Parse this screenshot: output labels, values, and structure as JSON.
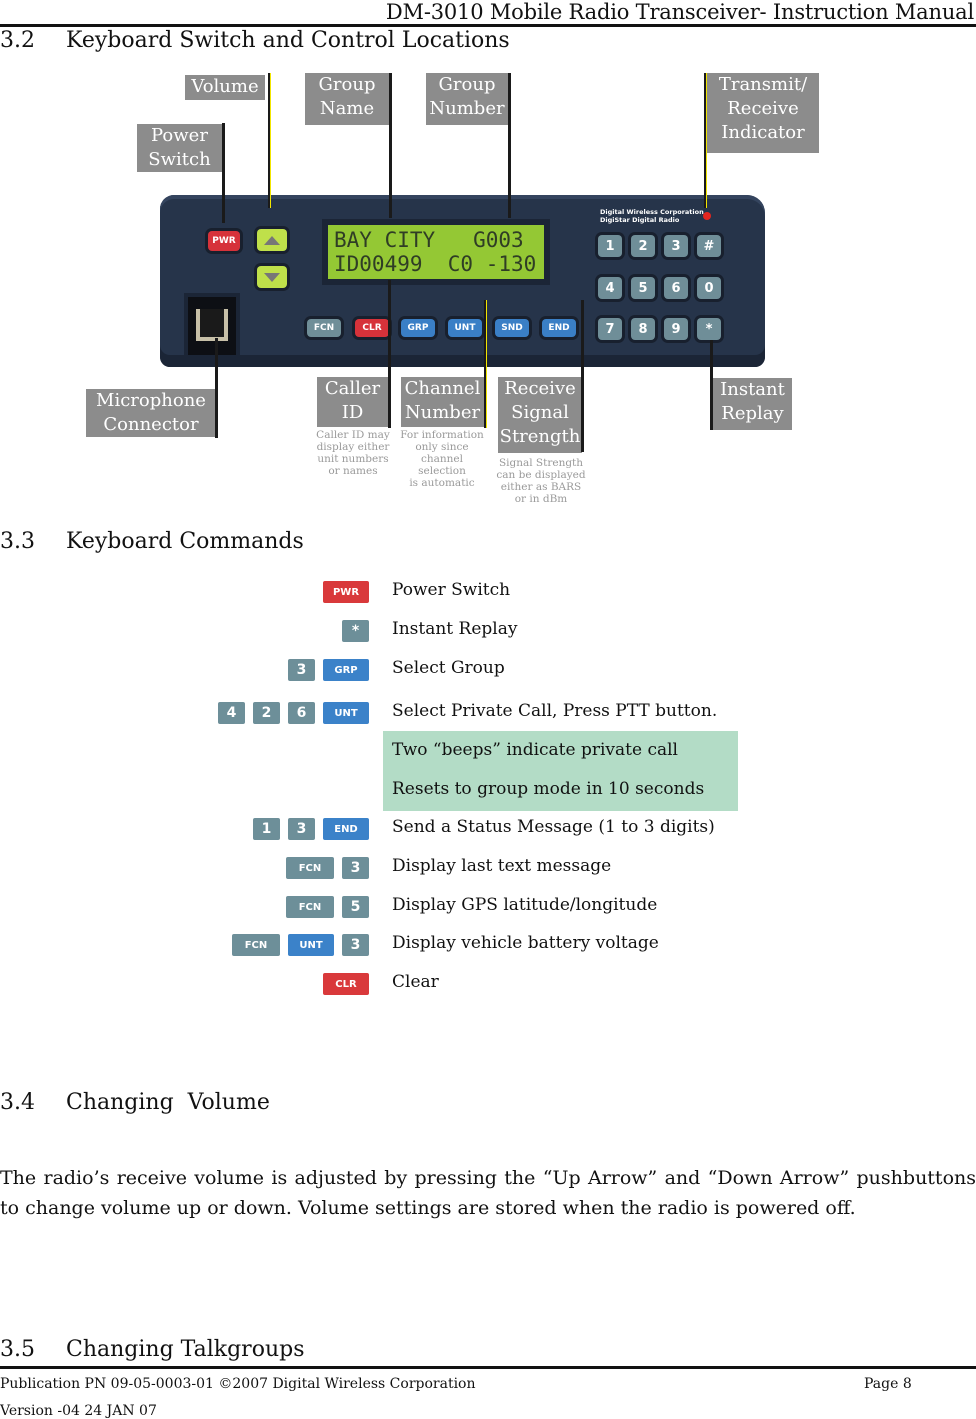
{
  "header": {
    "title": "DM-3010 Mobile Radio Transceiver- Instruction Manual"
  },
  "section_3_2": {
    "number": "3.2",
    "title": "Keyboard Switch and Control Locations",
    "callouts": {
      "volume": "Volume",
      "power_switch": [
        "Power",
        "Switch"
      ],
      "group_name": [
        "Group",
        "Name"
      ],
      "group_number": [
        "Group",
        "Number"
      ],
      "tx_rx_indicator": [
        "Transmit/",
        "Receive",
        "Indicator"
      ],
      "microphone_connector": [
        "Microphone",
        "Connector"
      ],
      "caller_id": [
        "Caller",
        "ID"
      ],
      "channel_number": [
        "Channel",
        "Number"
      ],
      "receive_signal_strength": [
        "Receive",
        "Signal",
        "Strength"
      ],
      "instant_replay": [
        "Instant",
        "Replay"
      ]
    },
    "notes": {
      "caller_id": [
        "Caller ID may",
        "display either",
        "unit numbers",
        "or names"
      ],
      "channel_number": [
        "For information",
        "only since",
        "channel selection",
        "is automatic"
      ],
      "signal_strength": [
        "Signal Strength",
        "can be displayed",
        "either as BARS",
        "or in dBm"
      ]
    },
    "device": {
      "lcd_line1": "BAY CITY   G003",
      "lcd_line2": "ID00499  C0 -130",
      "brand_line1": "Digital Wireless Corporation",
      "brand_line2": "DigiStar Digital Radio",
      "power_key": "PWR",
      "function_keys": [
        "FCN",
        "CLR",
        "GRP",
        "UNT",
        "SND",
        "END"
      ],
      "keypad": [
        "1",
        "2",
        "3",
        "#",
        "4",
        "5",
        "6",
        "0",
        "7",
        "8",
        "9",
        "*"
      ],
      "led_color": "#e5261f"
    }
  },
  "section_3_3": {
    "number": "3.3",
    "title": "Keyboard Commands",
    "commands": [
      {
        "keys": [
          "PWR"
        ],
        "text": "Power Switch"
      },
      {
        "keys": [
          "*"
        ],
        "text": "Instant Replay"
      },
      {
        "keys": [
          "3",
          "GRP"
        ],
        "text": "Select Group"
      },
      {
        "keys": [
          "4",
          "2",
          "6",
          "UNT"
        ],
        "text": "Select Private Call, Press PTT button."
      },
      {
        "keys": [
          "1",
          "3",
          "END"
        ],
        "text": "Send a Status Message (1 to 3 digits)"
      },
      {
        "keys": [
          "FCN",
          "3"
        ],
        "text": "Display last text message"
      },
      {
        "keys": [
          "FCN",
          "5"
        ],
        "text": "Display GPS latitude/longitude"
      },
      {
        "keys": [
          "FCN",
          "UNT",
          "3"
        ],
        "text": "Display vehicle battery voltage"
      },
      {
        "keys": [
          "CLR"
        ],
        "text": "Clear"
      }
    ],
    "private_call_notes": [
      "Two “beeps” indicate private call",
      "Resets to group mode in 10 seconds"
    ],
    "highlight_color": "#b3dcc6"
  },
  "section_3_4": {
    "number": "3.4",
    "title": "Changing  Volume",
    "body": "The radio’s receive volume is adjusted by pressing the “Up Arrow” and “Down Arrow” pushbuttons to change volume up or down. Volume settings are stored when the radio is powered off."
  },
  "section_3_5": {
    "number": "3.5",
    "title": "Changing Talkgroups"
  },
  "footer": {
    "publication": "Publication PN 09-05-0003-01 ©2007 Digital Wireless Corporation",
    "page": "Page 8",
    "version": "Version -04 24 JAN 07"
  }
}
